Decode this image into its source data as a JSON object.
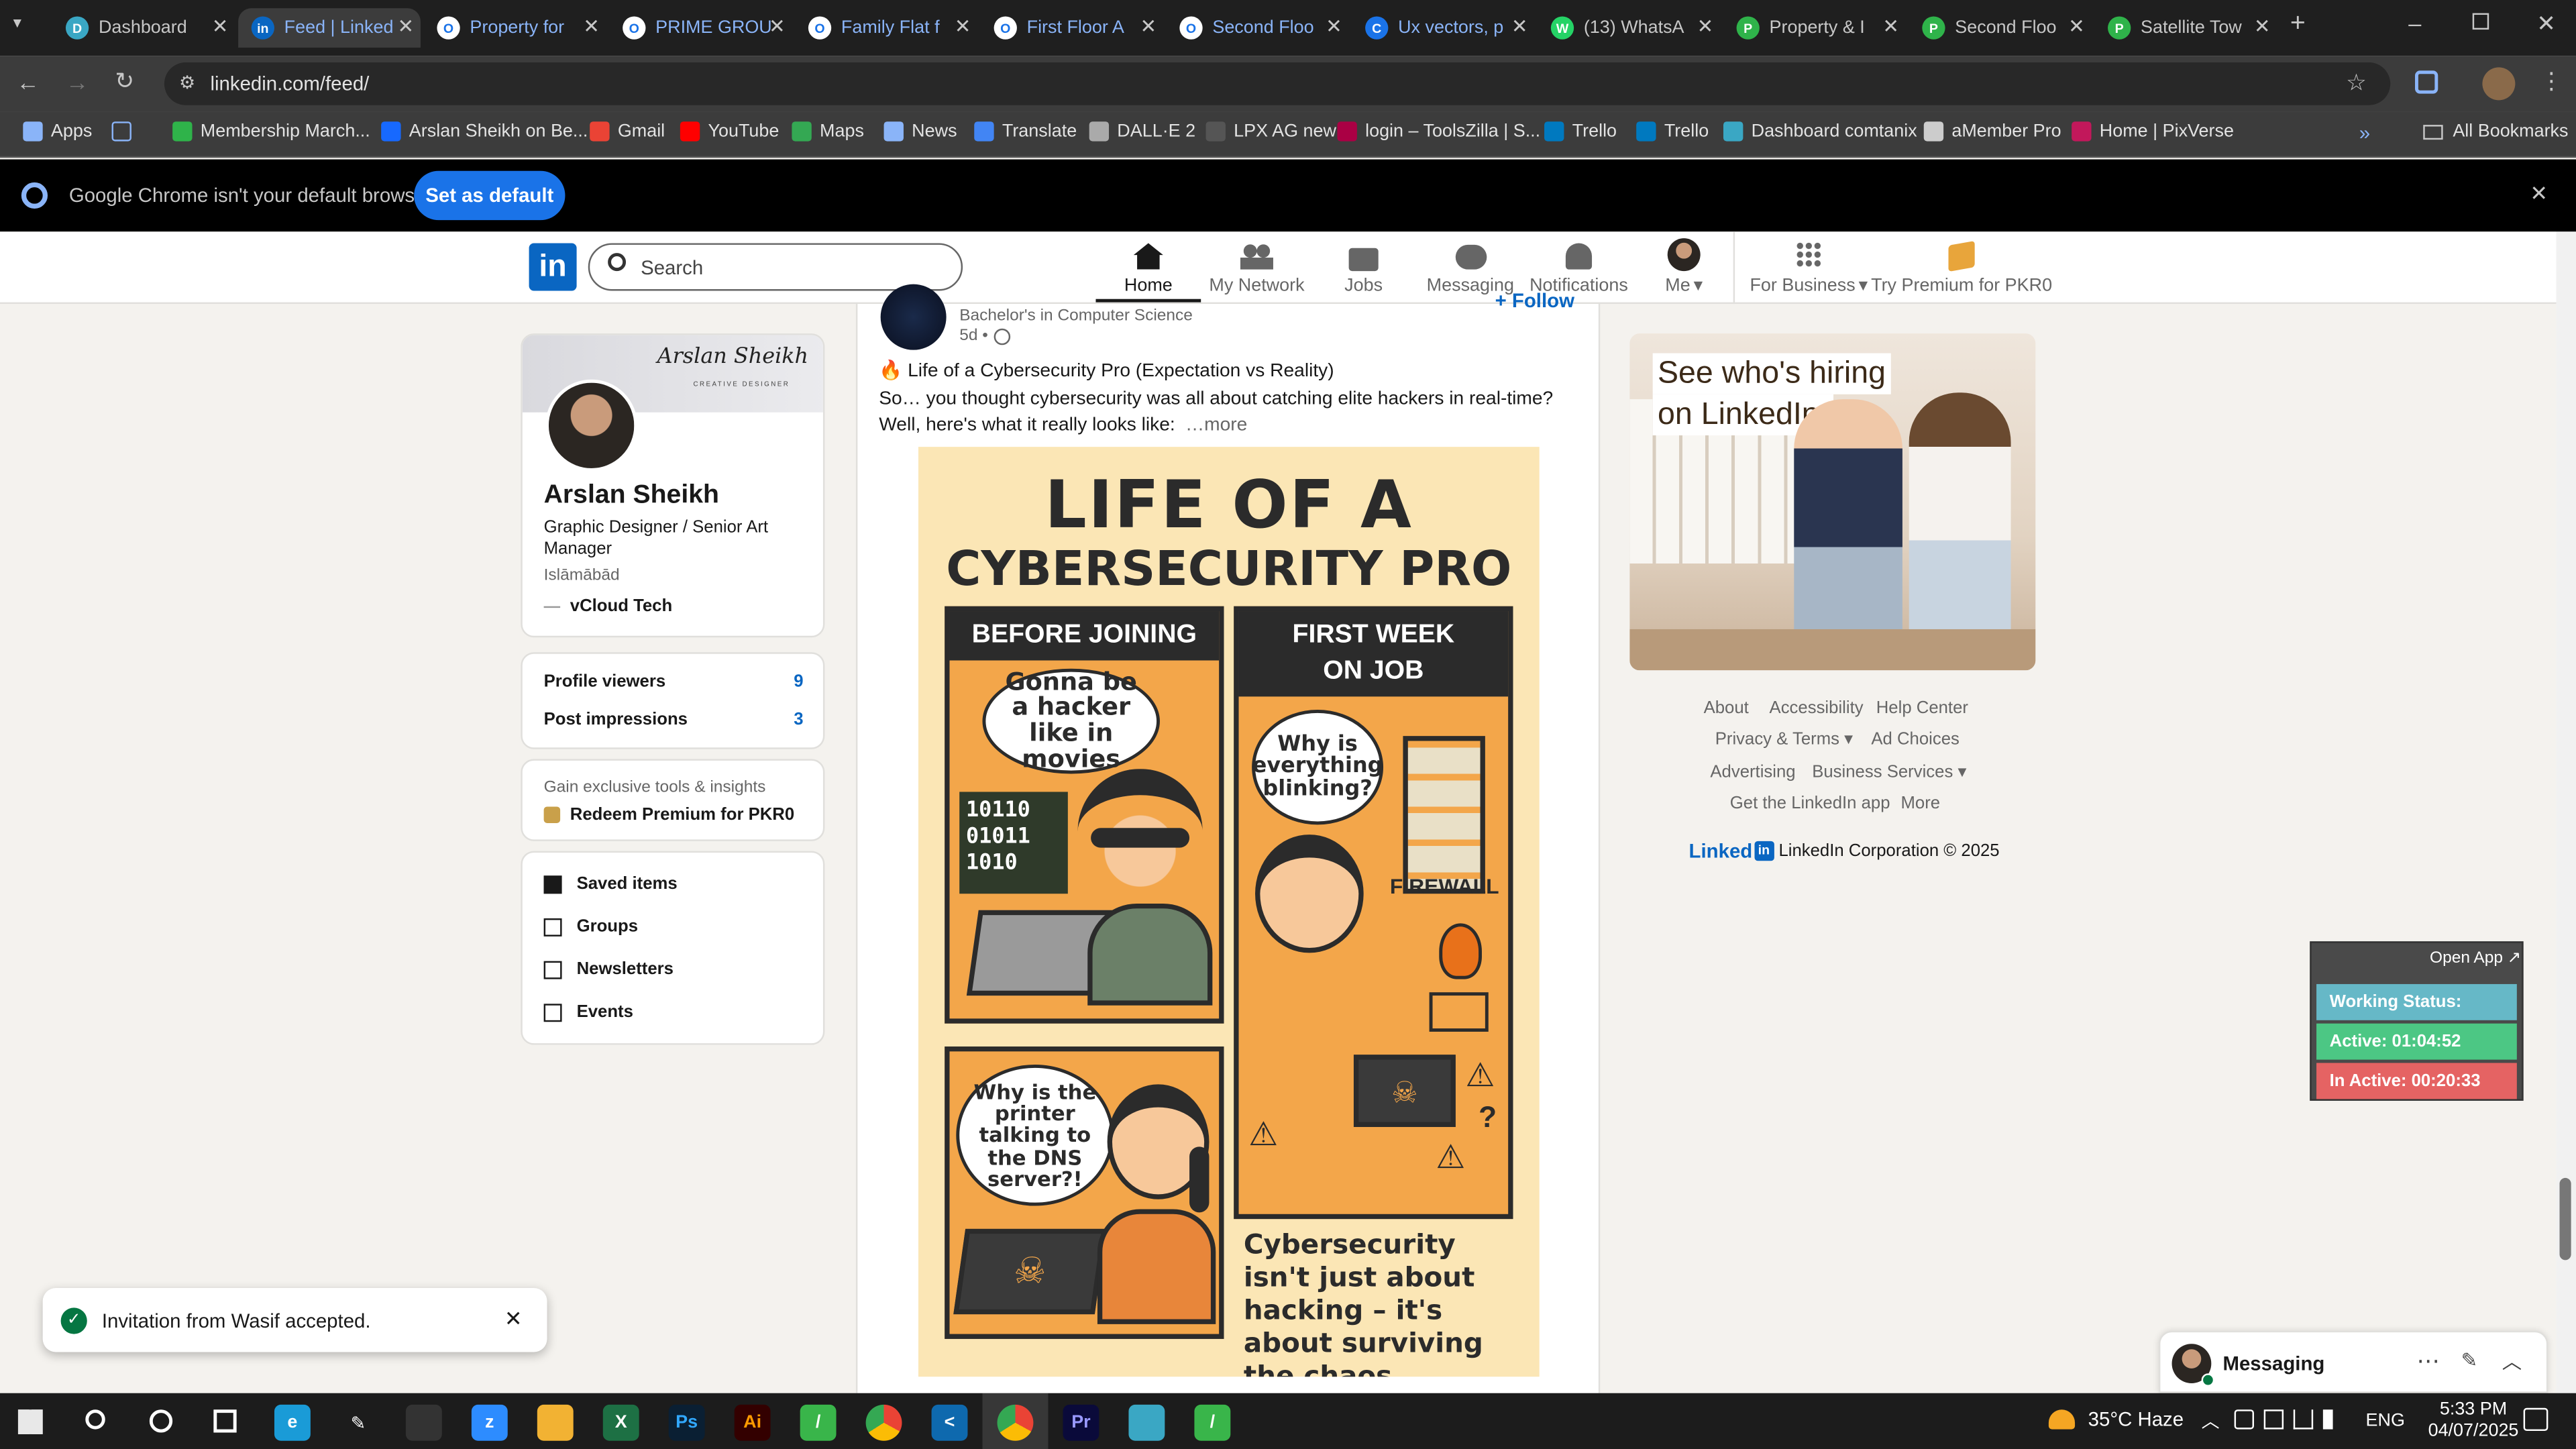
{
  "browser": {
    "tabs": [
      {
        "label": "Dashboard",
        "color": "#3aa7c4",
        "glyph": "D"
      },
      {
        "label": "Feed | Linked",
        "color": "#0a66c2",
        "glyph": "in"
      },
      {
        "label": "Property for",
        "color": "#ffffff",
        "glyph": "O"
      },
      {
        "label": "PRIME GROU",
        "color": "#ffffff",
        "glyph": "O"
      },
      {
        "label": "Family Flat f",
        "color": "#ffffff",
        "glyph": "O"
      },
      {
        "label": "First Floor A",
        "color": "#ffffff",
        "glyph": "O"
      },
      {
        "label": "Second Floo",
        "color": "#ffffff",
        "glyph": "O"
      },
      {
        "label": "Ux vectors, p",
        "color": "#1a73e8",
        "glyph": "C"
      },
      {
        "label": "(13) WhatsA",
        "color": "#25d366",
        "glyph": "W"
      },
      {
        "label": "Property & I",
        "color": "#2fb34a",
        "glyph": "P"
      },
      {
        "label": "Second Floo",
        "color": "#2fb34a",
        "glyph": "P"
      },
      {
        "label": "Satellite Tow",
        "color": "#2fb34a",
        "glyph": "P"
      }
    ],
    "url": "linkedin.com/feed/",
    "bookmarks": [
      {
        "label": "Apps",
        "color": "#8ab4f8"
      },
      {
        "label": "Membership March...",
        "color": "#2fb34a"
      },
      {
        "label": "Arslan Sheikh on Be...",
        "color": "#1769ff"
      },
      {
        "label": "Gmail",
        "color": "#ea4335"
      },
      {
        "label": "YouTube",
        "color": "#ff0000"
      },
      {
        "label": "Maps",
        "color": "#34a853"
      },
      {
        "label": "News",
        "color": "#8ab4f8"
      },
      {
        "label": "Translate",
        "color": "#4285f4"
      },
      {
        "label": "DALL·E 2",
        "color": "#aaaaaa"
      },
      {
        "label": "LPX AG new",
        "color": "#555555"
      },
      {
        "label": "login – ToolsZilla | S...",
        "color": "#a04"
      },
      {
        "label": "Trello",
        "color": "#0079bf"
      },
      {
        "label": "Trello",
        "color": "#0079bf"
      },
      {
        "label": "Dashboard comtanix",
        "color": "#3aa7c4"
      },
      {
        "label": "aMember Pro",
        "color": "#cccccc"
      },
      {
        "label": "Home | PixVerse",
        "color": "#c2185b"
      }
    ],
    "all_bookmarks": "All Bookmarks",
    "infobar": {
      "message": "Google Chrome isn't your default browser",
      "button": "Set as default"
    }
  },
  "linkedin": {
    "search_placeholder": "Search",
    "nav": [
      {
        "label": "Home"
      },
      {
        "label": "My Network"
      },
      {
        "label": "Jobs"
      },
      {
        "label": "Messaging"
      },
      {
        "label": "Notifications"
      },
      {
        "label": "Me"
      },
      {
        "label": "For Business"
      },
      {
        "label": "Try Premium for PKR0"
      }
    ],
    "profile": {
      "banner_name": "Arslan Sheikh",
      "banner_sub": "CREATIVE DESIGNER",
      "name": "Arslan Sheikh",
      "headline": "Graphic Designer / Senior Art Manager",
      "location": "Islāmābād",
      "company": "vCloud Tech",
      "stats": [
        {
          "label": "Profile viewers",
          "value": "9"
        },
        {
          "label": "Post impressions",
          "value": "3"
        }
      ],
      "premium_teaser": "Gain exclusive tools & insights",
      "premium_link": "Redeem Premium for PKR0",
      "shortcuts": [
        "Saved items",
        "Groups",
        "Newsletters",
        "Events"
      ]
    },
    "post": {
      "author_subtitle": "Bachelor's in Computer Science",
      "age": "5d •",
      "follow": "+ Follow",
      "line1": "Life of a Cybersecurity Pro (Expectation vs Reality)",
      "line2": "So… you thought cybersecurity was all about catching elite hackers in real-time?",
      "line3": "Well, here's what it really looks like:",
      "more": "…more",
      "image": {
        "title1": "LIFE OF A",
        "title2": "CYBERSECURITY PRO",
        "panel1": "BEFORE JOINING",
        "bubble1": "Gonna be a hacker like in movies",
        "binary": [
          "10110",
          "01011",
          "1010"
        ],
        "panel2a": "FIRST WEEK",
        "panel2b": "ON JOB",
        "bubble2": "Why is everything blinking?",
        "firewall": "FIREWALL",
        "bubble3": "Why is the printer talking to the DNS server?!",
        "caption": "Cybersecurity isn't just about hacking – it's about surviving the chaos"
      }
    },
    "ad": {
      "line1": "See who's hiring",
      "line2": "on LinkedIn."
    },
    "footer": {
      "links": [
        "About",
        "Accessibility",
        "Help Center",
        "Privacy & Terms",
        "Ad Choices",
        "Advertising",
        "Business Services",
        "Get the LinkedIn app",
        "More"
      ],
      "brand": "Linked",
      "copyright": "LinkedIn Corporation © 2025"
    },
    "messaging": {
      "label": "Messaging"
    },
    "toast": {
      "message": "Invitation from Wasif accepted."
    }
  },
  "status_widget": {
    "open_app": "Open App ↗",
    "working": "Working Status: Active",
    "active": "Active: 01:04:52",
    "inactive": "In Active: 00:20:33"
  },
  "taskbar": {
    "weather": "35°C Haze",
    "lang": "ENG",
    "time": "5:33 PM",
    "date": "04/07/2025"
  }
}
